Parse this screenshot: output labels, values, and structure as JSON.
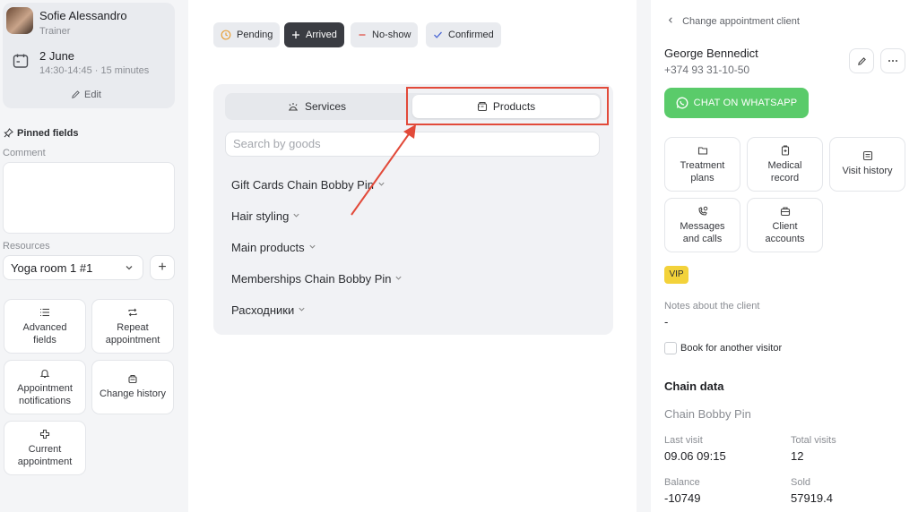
{
  "employee": {
    "name": "Sofie Alessandro",
    "role": "Trainer",
    "date": "2 June",
    "time": "14:30-14:45 · 15 minutes",
    "edit_label": "Edit"
  },
  "pinned": {
    "title": "Pinned fields",
    "comment_label": "Comment",
    "resources_label": "Resources",
    "resource_value": "Yoga room 1 #1"
  },
  "left_actions": [
    {
      "label_1": "Advanced",
      "label_2": "fields"
    },
    {
      "label_1": "Repeat",
      "label_2": "appointment"
    },
    {
      "label_1": "Appointment",
      "label_2": "notifications"
    },
    {
      "label_1": "Change history",
      "label_2": ""
    },
    {
      "label_1": "Current",
      "label_2": "appointment"
    }
  ],
  "status_buttons": [
    {
      "label": "Pending"
    },
    {
      "label": "Arrived"
    },
    {
      "label": "No-show"
    },
    {
      "label": "Confirmed"
    }
  ],
  "tabs": {
    "services": "Services",
    "products": "Products"
  },
  "search": {
    "placeholder": "Search by goods"
  },
  "categories": [
    {
      "label": "Gift Cards Chain Bobby Pin"
    },
    {
      "label": "Hair styling"
    },
    {
      "label": "Main products"
    },
    {
      "label": "Memberships Chain Bobby Pin"
    },
    {
      "label": "Расходники"
    }
  ],
  "client": {
    "back_label": "Change appointment client",
    "name": "George Bennedict",
    "phone": "+374 93 31-10-50",
    "whatsapp_label": "CHAT ON WHATSAPP",
    "vip_label": "VIP",
    "notes_label": "Notes about the client",
    "notes_value": "-",
    "book_other_label": "Book for another visitor"
  },
  "client_actions": [
    {
      "label_1": "Treatment",
      "label_2": "plans"
    },
    {
      "label_1": "Medical",
      "label_2": "record"
    },
    {
      "label_1": "Visit history",
      "label_2": ""
    },
    {
      "label_1": "Messages",
      "label_2": "and calls"
    },
    {
      "label_1": "Client",
      "label_2": "accounts"
    }
  ],
  "chain": {
    "title": "Chain data",
    "name": "Chain Bobby Pin",
    "last_visit_label": "Last visit",
    "last_visit_value": "09.06 09:15",
    "total_visits_label": "Total visits",
    "total_visits_value": "12",
    "balance_label": "Balance",
    "balance_value": "-10749",
    "sold_label": "Sold",
    "sold_value": "57919.4"
  },
  "colors": {
    "whatsapp": "#5acb6a",
    "highlight": "#e24a3a",
    "vip": "#f3d23a",
    "arrived_bg": "#3a3c42"
  }
}
